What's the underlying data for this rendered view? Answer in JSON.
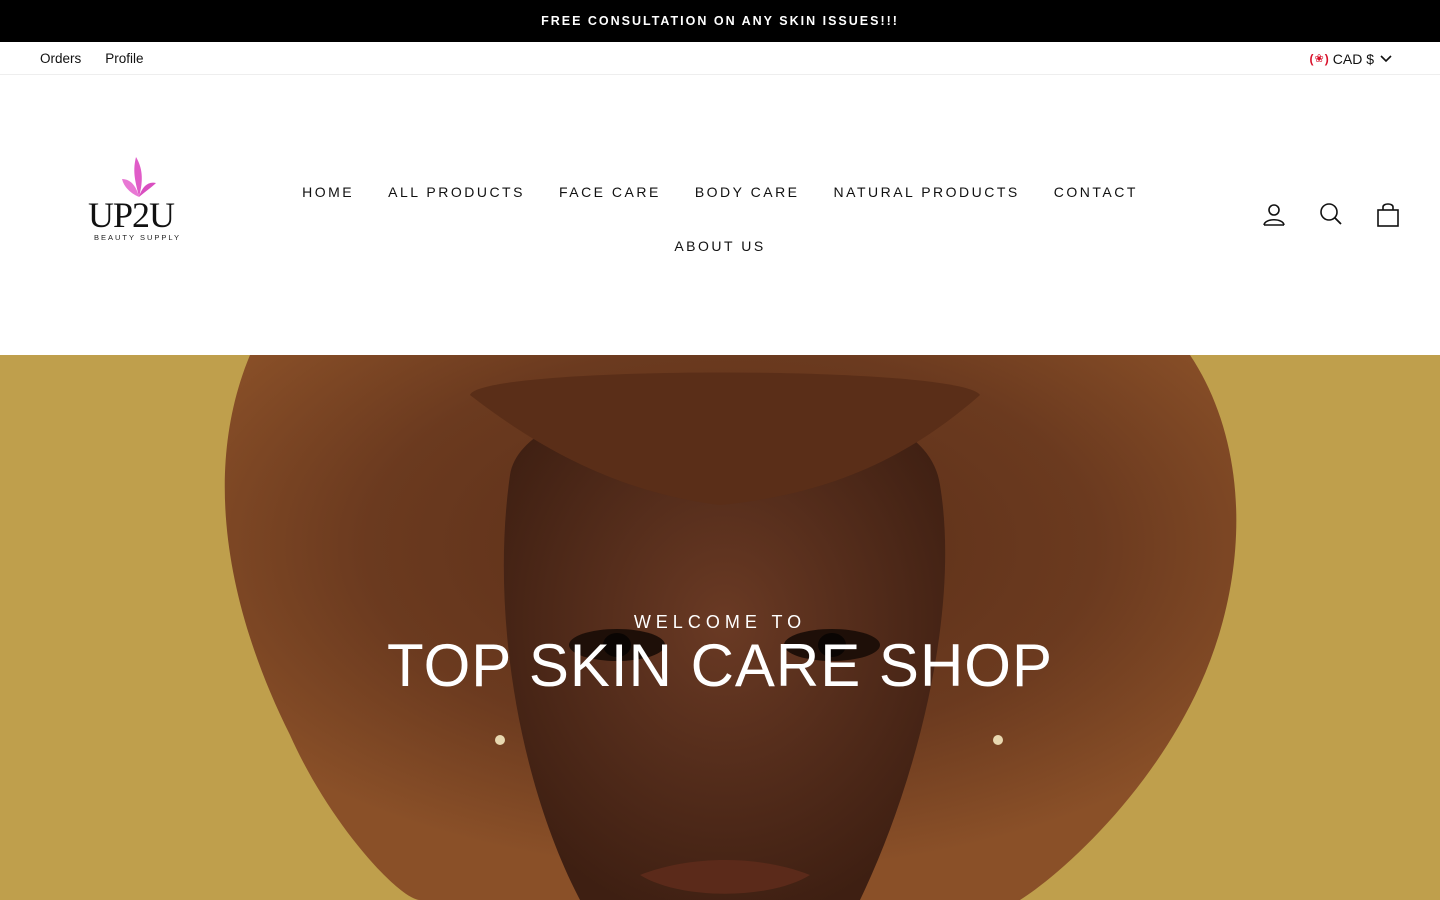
{
  "announcement": "FREE CONSULTATION ON ANY SKIN ISSUES!!!",
  "utility": {
    "links": [
      "Orders",
      "Profile"
    ],
    "currency": "CAD $"
  },
  "logo": {
    "brand": "UP2U",
    "tagline": "BEAUTY SUPPLY"
  },
  "nav": {
    "items": [
      "HOME",
      "ALL PRODUCTS",
      "FACE CARE",
      "BODY CARE",
      "NATURAL PRODUCTS",
      "CONTACT",
      "ABOUT US"
    ]
  },
  "header_icons": [
    "account-icon",
    "search-icon",
    "cart-icon"
  ],
  "hero": {
    "eyebrow": "WELCOME TO",
    "title": "TOP SKIN CARE SHOP"
  },
  "colors": {
    "announcement_bg": "#000000",
    "hero_bg": "#bf9f4c",
    "logo_accent": "#e05cc8"
  }
}
